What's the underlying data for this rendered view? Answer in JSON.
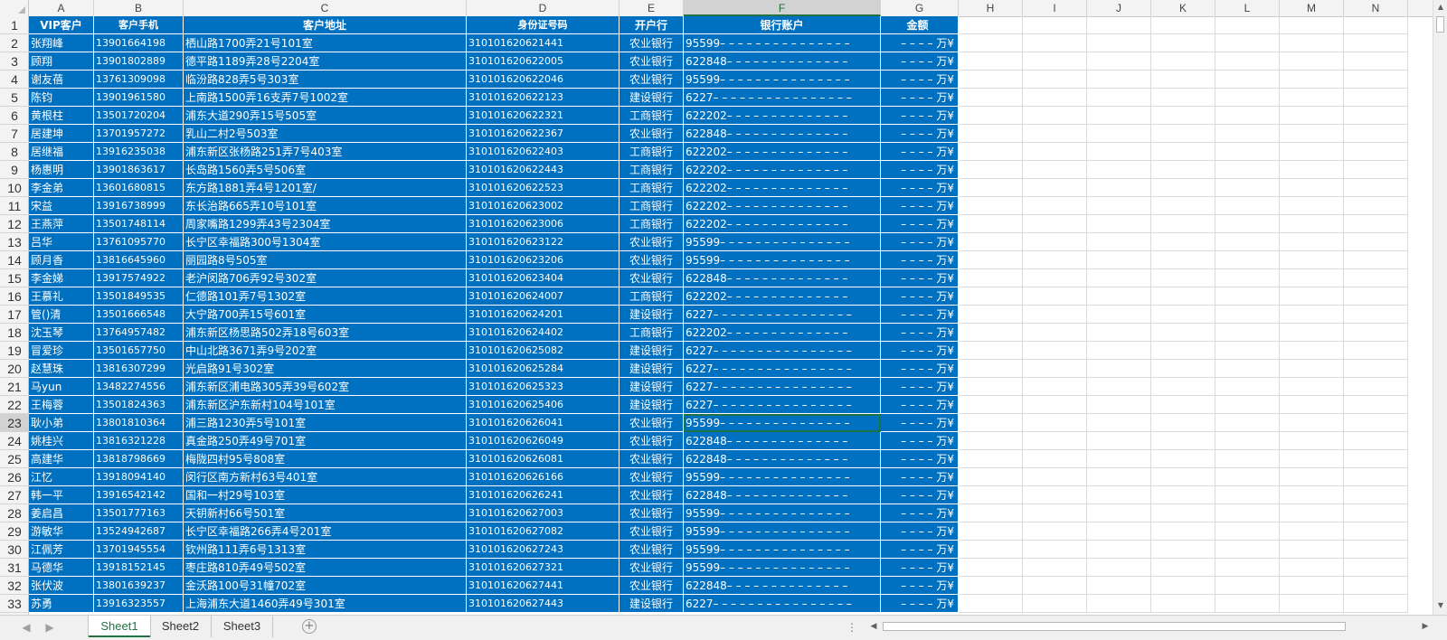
{
  "columns": [
    "A",
    "B",
    "C",
    "D",
    "E",
    "F",
    "G",
    "H",
    "I",
    "J",
    "K",
    "L",
    "M",
    "N"
  ],
  "active_column": "F",
  "active_row": "23",
  "row_numbers": [
    "1",
    "2",
    "3",
    "4",
    "5",
    "6",
    "7",
    "8",
    "9",
    "10",
    "11",
    "12",
    "13",
    "14",
    "15",
    "16",
    "17",
    "18",
    "19",
    "20",
    "21",
    "22",
    "23",
    "24",
    "25",
    "26",
    "27",
    "28",
    "29",
    "30",
    "31",
    "32",
    "33"
  ],
  "header_row": [
    "VIP客户",
    "客户手机",
    "客户地址",
    "身份证号码",
    "开户行",
    "银行账户",
    "金额"
  ],
  "rows": [
    [
      "张翔峰",
      "13901664198",
      "栖山路1700弄21号101室",
      "310101620621441",
      "农业银行",
      "95599– – – – – – – – – – – – – – –",
      "– – – – 万¥"
    ],
    [
      "顾翔",
      "13901802889",
      "德平路1189弄28号2204室",
      "310101620622005",
      "农业银行",
      "622848– – – – – – – – – – – – – –",
      "– – – – 万¥"
    ],
    [
      "谢友蓓",
      "13761309098",
      "临汾路828弄5号303室",
      "310101620622046",
      "农业银行",
      "95599– – – – – – – – – – – – – – –",
      "– – – – 万¥"
    ],
    [
      "陈钧",
      "13901961580",
      "上南路1500弄16支弄7号1002室",
      "310101620622123",
      "建设银行",
      "6227– – – – – – – – – – – – – – – –",
      "– – – – 万¥"
    ],
    [
      "黄根柱",
      "13501720204",
      "浦东大道290弄15号505室",
      "310101620622321",
      "工商银行",
      "622202– – – – – – – – – – – – – –",
      "– – – – 万¥"
    ],
    [
      "居建坤",
      "13701957272",
      "乳山二村2号503室",
      "310101620622367",
      "农业银行",
      "622848– – – – – – – – – – – – – –",
      "– – – – 万¥"
    ],
    [
      "居继福",
      "13916235038",
      "浦东新区张杨路251弄7号403室",
      "310101620622403",
      "工商银行",
      "622202– – – – – – – – – – – – – –",
      "– – – – 万¥"
    ],
    [
      "杨惠明",
      "13901863617",
      "长岛路1560弄5号506室",
      "310101620622443",
      "工商银行",
      "622202– – – – – – – – – – – – – –",
      "– – – – 万¥"
    ],
    [
      "李金弟",
      "13601680815",
      "东方路1881弄4号1201室/",
      "310101620622523",
      "工商银行",
      "622202– – – – – – – – – – – – – –",
      "– – – – 万¥"
    ],
    [
      "宋益",
      "13916738999",
      "东长治路665弄10号101室",
      "310101620623002",
      "工商银行",
      "622202– – – – – – – – – – – – – –",
      "– – – – 万¥"
    ],
    [
      "王燕萍",
      "13501748114",
      "周家嘴路1299弄43号2304室",
      "310101620623006",
      "工商银行",
      "622202– – – – – – – – – – – – – –",
      "– – – – 万¥"
    ],
    [
      "吕华",
      "13761095770",
      "长宁区幸福路300号1304室",
      "310101620623122",
      "农业银行",
      "95599– – – – – – – – – – – – – – –",
      "– – – – 万¥"
    ],
    [
      "顾月香",
      "13816645960",
      "丽园路8号505室",
      "310101620623206",
      "农业银行",
      "95599– – – – – – – – – – – – – – –",
      "– – – – 万¥"
    ],
    [
      "李金娣",
      "13917574922",
      "老沪闵路706弄92号302室",
      "310101620623404",
      "农业银行",
      "622848– – – – – – – – – – – – – –",
      "– – – – 万¥"
    ],
    [
      "王慕礼",
      "13501849535",
      "仁德路101弄7号1302室",
      "310101620624007",
      "工商银行",
      "622202– – – – – – – – – – – – – –",
      "– – – – 万¥"
    ],
    [
      "管()清",
      "13501666548",
      "大宁路700弄15号601室",
      "310101620624201",
      "建设银行",
      "6227– – – – – – – – – – – – – – – –",
      "– – – – 万¥"
    ],
    [
      "沈玉琴",
      "13764957482",
      "浦东新区杨思路502弄18号603室",
      "310101620624402",
      "工商银行",
      "622202– – – – – – – – – – – – – –",
      "– – – – 万¥"
    ],
    [
      "冒爱珍",
      "13501657750",
      "中山北路3671弄9号202室",
      "310101620625082",
      "建设银行",
      "6227– – – – – – – – – – – – – – – –",
      "– – – – 万¥"
    ],
    [
      "赵慧珠",
      "13816307299",
      "光启路91号302室",
      "310101620625284",
      "建设银行",
      "6227– – – – – – – – – – – – – – – –",
      "– – – – 万¥"
    ],
    [
      "马yun",
      "13482274556",
      "浦东新区浦电路305弄39号602室",
      "310101620625323",
      "建设银行",
      "6227– – – – – – – – – – – – – – – –",
      "– – – – 万¥"
    ],
    [
      "王梅蓉",
      "13501824363",
      "浦东新区沪东新村104号101室",
      "310101620625406",
      "建设银行",
      "6227– – – – – – – – – – – – – – – –",
      "– – – – 万¥"
    ],
    [
      "耿小弟",
      "13801810364",
      "浦三路1230弄5号101室",
      "310101620626041",
      "农业银行",
      "95599– – – – – – – – – – – – – – –",
      "– – – – 万¥"
    ],
    [
      "姚桂兴",
      "13816321228",
      "真金路250弄49号701室",
      "310101620626049",
      "农业银行",
      "622848– – – – – – – – – – – – – –",
      "– – – – 万¥"
    ],
    [
      "高建华",
      "13818798669",
      "梅陇四村95号808室",
      "310101620626081",
      "农业银行",
      "622848– – – – – – – – – – – – – –",
      "– – – – 万¥"
    ],
    [
      "江忆",
      "13918094140",
      "闵行区南方新村63号401室",
      "310101620626166",
      "农业银行",
      "95599– – – – – – – – – – – – – – –",
      "– – – – 万¥"
    ],
    [
      "韩一平",
      "13916542142",
      "国和一村29号103室",
      "310101620626241",
      "农业银行",
      "622848– – – – – – – – – – – – – –",
      "– – – – 万¥"
    ],
    [
      "姜启昌",
      "13501777163",
      "天钥新村66号501室",
      "310101620627003",
      "农业银行",
      "95599– – – – – – – – – – – – – – –",
      "– – – – 万¥"
    ],
    [
      "游敏华",
      "13524942687",
      "长宁区幸福路266弄4号201室",
      "310101620627082",
      "农业银行",
      "95599– – – – – – – – – – – – – – –",
      "– – – – 万¥"
    ],
    [
      "江佩芳",
      "13701945554",
      "钦州路111弄6号1313室",
      "310101620627243",
      "农业银行",
      "95599– – – – – – – – – – – – – – –",
      "– – – – 万¥"
    ],
    [
      "马德华",
      "13918152145",
      "枣庄路810弄49号502室",
      "310101620627321",
      "农业银行",
      "95599– – – – – – – – – – – – – – –",
      "– – – – 万¥"
    ],
    [
      "张伏波",
      "13801639237",
      "金沃路100号31幢702室",
      "310101620627441",
      "农业银行",
      "622848– – – – – – – – – – – – – –",
      "– – – – 万¥"
    ],
    [
      "苏勇",
      "13916323557",
      "上海浦东大道1460弄49号301室",
      "310101620627443",
      "建设银行",
      "6227– – – – – – – – – – – – – – – –",
      "– – – – 万¥"
    ]
  ],
  "sheets": [
    "Sheet1",
    "Sheet2",
    "Sheet3"
  ],
  "active_sheet": "Sheet1",
  "colors": {
    "selection_fill": "#0070c0",
    "selection_text": "#ffffff",
    "active_accent": "#217346"
  }
}
